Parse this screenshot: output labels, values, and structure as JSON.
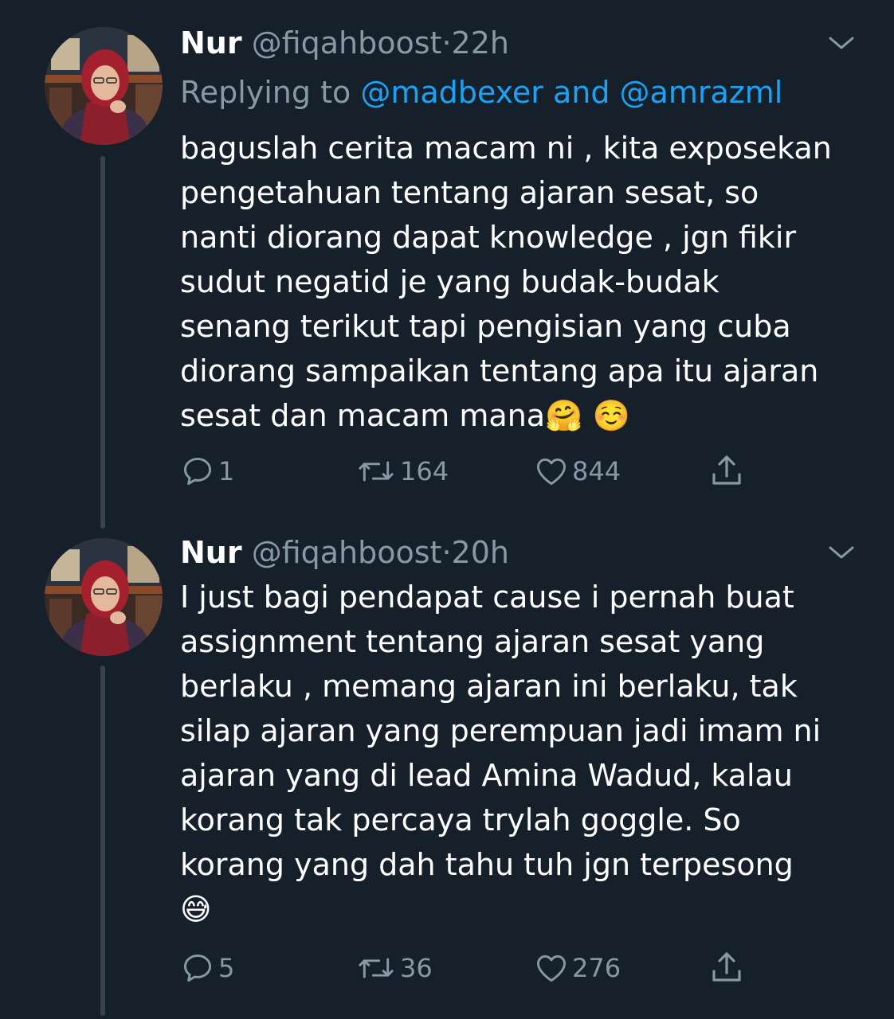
{
  "colors": {
    "background": "#15202b",
    "text": "#ffffff",
    "secondary": "#8899a6",
    "link": "#1da1f2",
    "thread_line": "#38444d"
  },
  "tweets": [
    {
      "name": "Nur",
      "handle": "@fiqahboost",
      "separator": "·",
      "time": "22h",
      "replying_prefix": "Replying to ",
      "mention_1": "@madbexer",
      "mention_join": " and ",
      "mention_2": "@amrazml",
      "text": "baguslah cerita macam ni , kita exposekan\npengetahuan tentang ajaran sesat, so\nnanti diorang dapat knowledge , jgn fikir\nsudut negatid je yang budak-budak\nsenang terikut tapi pengisian yang cuba\ndiorang sampaikan tentang apa itu ajaran\nsesat dan macam mana🤗 ☺️",
      "replies": "1",
      "retweets": "164",
      "likes": "844",
      "icons": [
        "avatar",
        "chevron-down-icon",
        "reply-icon",
        "retweet-icon",
        "heart-icon",
        "share-icon"
      ]
    },
    {
      "name": "Nur",
      "handle": "@fiqahboost",
      "separator": "·",
      "time": "20h",
      "text": "I just bagi pendapat cause i pernah buat\nassignment tentang ajaran sesat yang\nberlaku , memang ajaran ini berlaku, tak\nsilap ajaran yang perempuan jadi imam ni\najaran yang di lead Amina Wadud, kalau\nkorang tak percaya trylah goggle. So\nkorang yang dah tahu tuh jgn terpesong\n😅",
      "replies": "5",
      "retweets": "36",
      "likes": "276",
      "icons": [
        "avatar",
        "chevron-down-icon",
        "reply-icon",
        "retweet-icon",
        "heart-icon",
        "share-icon"
      ]
    }
  ]
}
